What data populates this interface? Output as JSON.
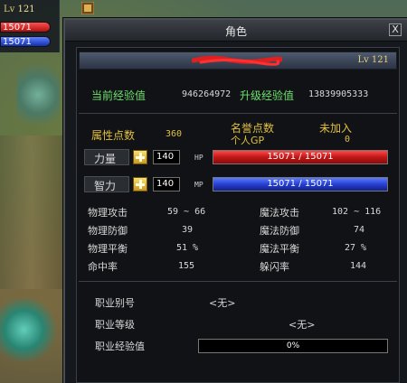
{
  "mini_status": {
    "level_prefix": "Lv",
    "level": "121",
    "hp": "15071",
    "mp": "15071"
  },
  "window": {
    "title": "角色",
    "close_label": "X"
  },
  "character": {
    "level_label": "Lv 121"
  },
  "experience": {
    "current_label": "当前经验值",
    "current_value": "946264972",
    "upgrade_label": "升级经验值",
    "upgrade_value": "13839905333"
  },
  "points": {
    "attr_label": "属性点数",
    "attr_value": "360",
    "fame_label_1": "名誉点数",
    "fame_label_2": "个人GP",
    "joined_label": "未加入",
    "gp_value": "0"
  },
  "stats": {
    "strength_label": "力量",
    "strength_value": "140",
    "hp_tag": "HP",
    "hp_text": "15071 / 15071",
    "hp_fraction": 1.0,
    "intellect_label": "智力",
    "intellect_value": "140",
    "mp_tag": "MP",
    "mp_text": "15071 / 15071",
    "mp_fraction": 1.0
  },
  "combat": {
    "phys_atk_label": "物理攻击",
    "phys_atk_value": "59 ~ 66",
    "mag_atk_label": "魔法攻击",
    "mag_atk_value": "102 ~ 116",
    "phys_def_label": "物理防御",
    "phys_def_value": "39",
    "mag_def_label": "魔法防御",
    "mag_def_value": "74",
    "phys_bal_label": "物理平衡",
    "phys_bal_value": "51 %",
    "mag_bal_label": "魔法平衡",
    "mag_bal_value": "27 %",
    "hit_label": "命中率",
    "hit_value": "155",
    "dodge_label": "躲闪率",
    "dodge_value": "144"
  },
  "job": {
    "alias_label": "职业别号",
    "alias_value": "<无>",
    "grade_label": "职业等级",
    "grade_value": "<无>",
    "exp_label": "职业经验值",
    "exp_text": "0%",
    "exp_fraction": 0
  },
  "colors": {
    "green_label": "#6ee06e",
    "yellow_label": "#e0c040",
    "hp_red": "#c01818",
    "mp_blue": "#2840d0"
  }
}
